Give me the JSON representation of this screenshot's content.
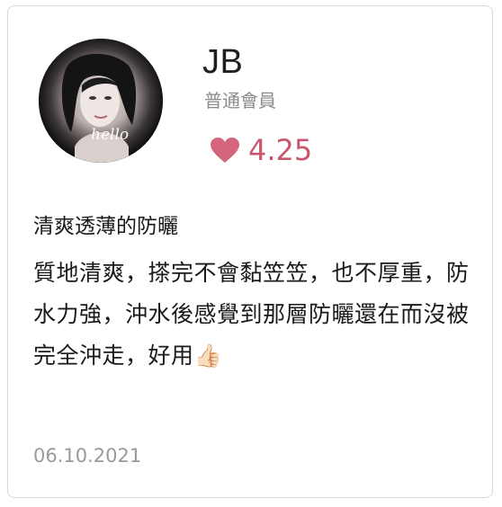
{
  "review": {
    "user_name": "JB",
    "member_level": "普通會員",
    "rating": "4.25",
    "title": "清爽透薄的防曬",
    "body": "質地清爽，搽完不會黏笠笠，也不厚重，防水力強，沖水後感覺到那層防曬還在而沒被完全沖走，好用👍🏻",
    "date": "06.10.2021",
    "avatar_script_text": "hello"
  },
  "colors": {
    "heart": "#d4657d",
    "rating_text": "#c9566c",
    "muted_text": "#8a8a8a",
    "border": "#d9d9d9"
  },
  "icons": {
    "rating": "heart-icon"
  }
}
